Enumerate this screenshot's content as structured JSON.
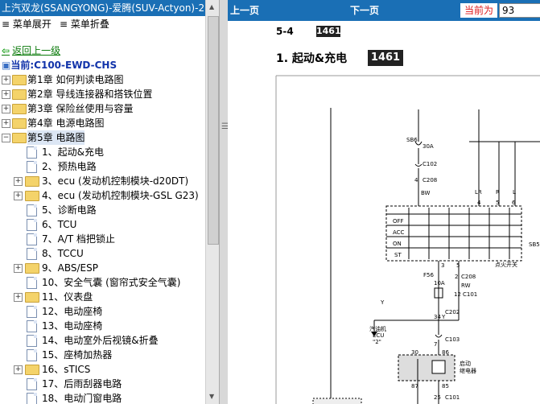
{
  "window": {
    "title": "上汽双龙(SSANGYONG)-爱腾(SUV-Actyon)-2"
  },
  "menu": {
    "expand": "菜单展开",
    "collapse": "菜单折叠"
  },
  "nav": {
    "back": "返回上一级",
    "current_prefix": "当前:",
    "current": "C100-EWD-CHS"
  },
  "tree": {
    "chapters_top": [
      {
        "label": "第1章  如何判读电路图"
      },
      {
        "label": "第2章  导线连接器和搭铁位置"
      },
      {
        "label": "第3章  保险丝使用与容量"
      },
      {
        "label": "第4章  电源电路图"
      }
    ],
    "chapter5": "第5章  电路图",
    "children": [
      {
        "label": "1、起动&充电",
        "type": "doc"
      },
      {
        "label": "2、预热电路",
        "type": "doc"
      },
      {
        "label": "3、ecu (发动机控制模块-d20DT)",
        "type": "folder"
      },
      {
        "label": "4、ecu (发动机控制模块-GSL G23)",
        "type": "folder"
      },
      {
        "label": "5、诊断电路",
        "type": "doc"
      },
      {
        "label": "6、TCU",
        "type": "doc"
      },
      {
        "label": "7、A/T 档把锁止",
        "type": "doc"
      },
      {
        "label": "8、TCCU",
        "type": "doc"
      },
      {
        "label": "9、ABS/ESP",
        "type": "folder"
      },
      {
        "label": "10、安全气囊 (窗帘式安全气囊)",
        "type": "doc"
      },
      {
        "label": "11、仪表盘",
        "type": "folder"
      },
      {
        "label": "12、电动座椅",
        "type": "doc"
      },
      {
        "label": "13、电动座椅",
        "type": "doc"
      },
      {
        "label": "14、电动室外后视镜&折叠",
        "type": "doc"
      },
      {
        "label": "15、座椅加热器",
        "type": "doc"
      },
      {
        "label": "16、sTICS",
        "type": "folder"
      },
      {
        "label": "17、后雨刮器电路",
        "type": "doc"
      },
      {
        "label": "18、电动门窗电路",
        "type": "doc"
      }
    ]
  },
  "toolbar": {
    "prev": "上一页",
    "next": "下一页",
    "current_label": "当前为",
    "page_value": "93"
  },
  "doc": {
    "page_num": "5-4",
    "code": "1461",
    "heading": "1. 起动&充电",
    "diagram": {
      "fuse_sb6": "SB6",
      "fuse_sb6_amp": "30A",
      "c102": "C102",
      "c208": "C208",
      "pin4": "4",
      "bw": "BW",
      "pin_lr": "LR",
      "pin_r": "R",
      "pin_l": "L",
      "n4": "4",
      "n5": "5",
      "n6": "6",
      "sw_off": "OFF",
      "sw_acc": "ACC",
      "sw_on": "ON",
      "sw_st": "ST",
      "ign_label": "点火开关",
      "sb_right": "SB5",
      "n3": "3",
      "n5b": "5",
      "f56": "F56",
      "f56_amp": "10A",
      "c208b": "C208",
      "n2": "2",
      "rw": "RW",
      "c101": "C101",
      "n12": "12",
      "y1": "Y",
      "y2": "Y",
      "ecu_label": "汽油机",
      "ecu_label2": "ECU",
      "ecu_pin": "\"2\"",
      "c202": "C202",
      "n34": "34",
      "c103": "C103",
      "n7": "7",
      "r30": "30",
      "r86": "86",
      "r87": "87",
      "r85": "85",
      "relay_label": "启动",
      "relay_label2": "继电器",
      "c101b": "C101",
      "n25": "25"
    }
  }
}
